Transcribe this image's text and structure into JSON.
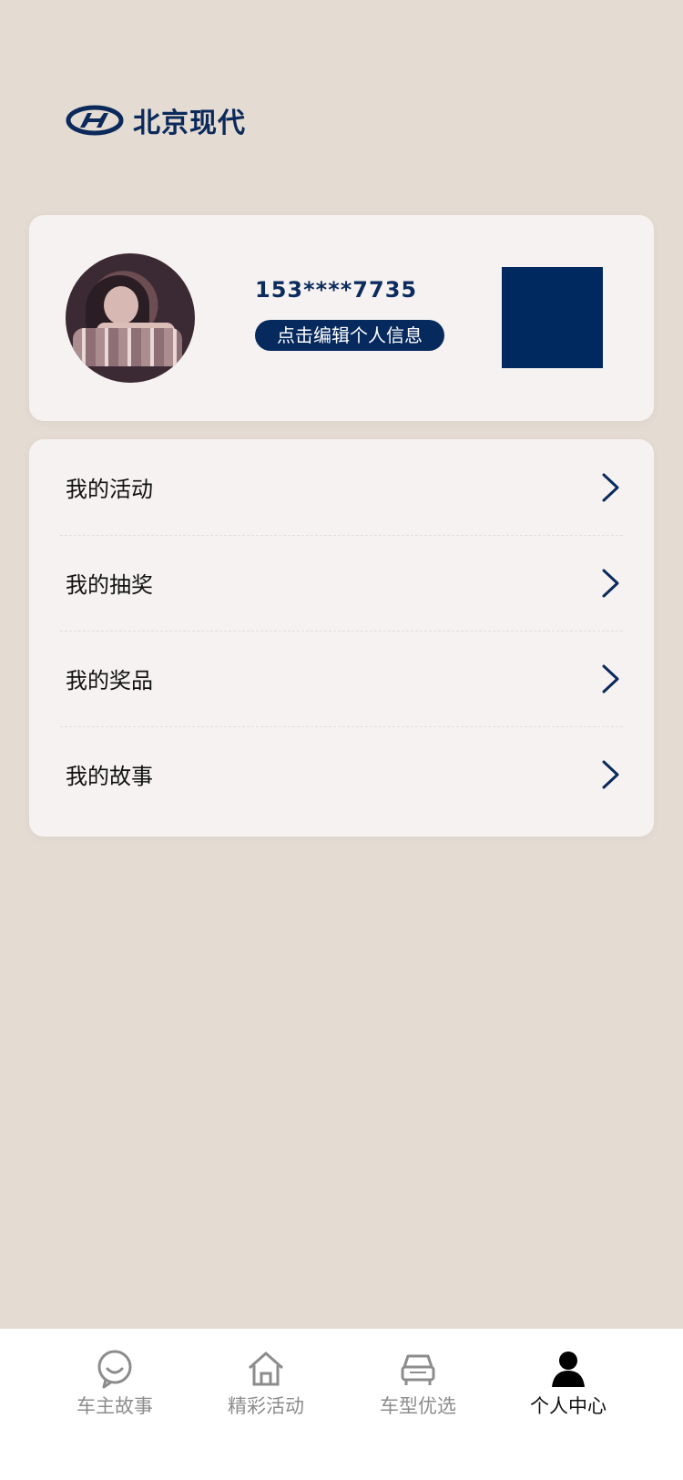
{
  "brand": {
    "name": "北京现代"
  },
  "profile": {
    "phone": "153****7735",
    "edit_label": "点击编辑个人信息"
  },
  "menu": {
    "items": [
      {
        "label": "我的活动",
        "icon": "chevron-right-icon"
      },
      {
        "label": "我的抽奖",
        "icon": "chevron-right-icon"
      },
      {
        "label": "我的奖品",
        "icon": "chevron-right-icon"
      },
      {
        "label": "我的故事",
        "icon": "chevron-right-icon"
      }
    ]
  },
  "tabs": [
    {
      "label": "车主故事",
      "icon": "chat-smile-icon"
    },
    {
      "label": "精彩活动",
      "icon": "home-icon"
    },
    {
      "label": "车型优选",
      "icon": "car-icon"
    },
    {
      "label": "个人中心",
      "icon": "person-icon",
      "active": true
    }
  ],
  "colors": {
    "background": "#e4dbd2",
    "card": "#f5f2f1",
    "brand_navy": "#072a5e",
    "tab_inactive": "#8c8c8c",
    "tab_active": "#111111"
  }
}
